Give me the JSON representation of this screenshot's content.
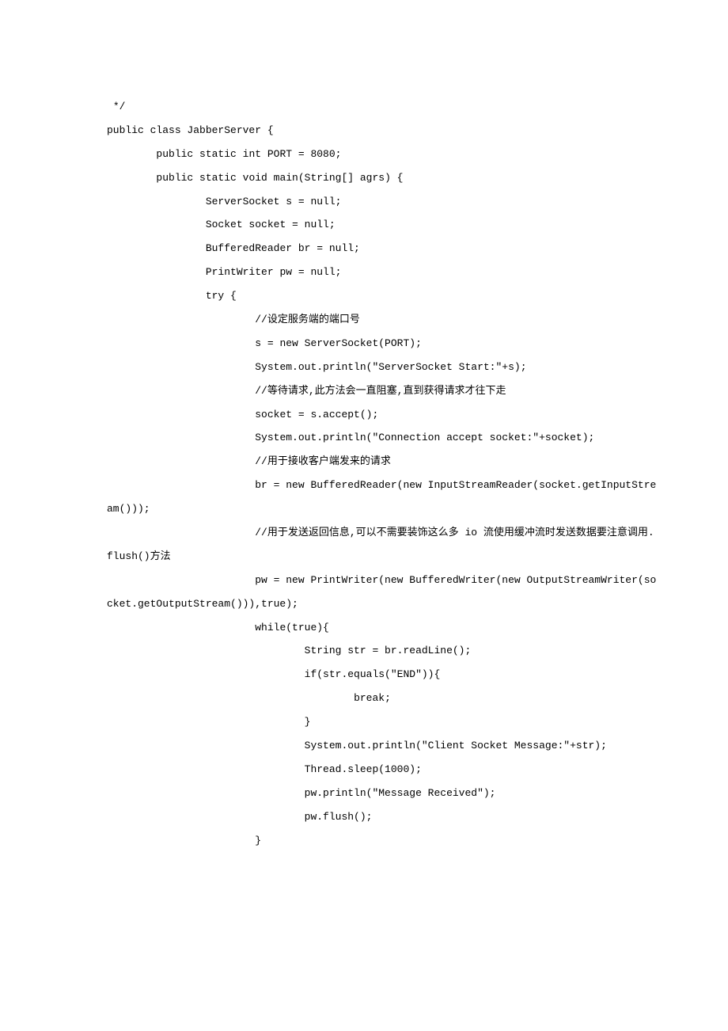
{
  "lines": [
    " */",
    "public class JabberServer {",
    "",
    "        public static int PORT = 8080;",
    "        public static void main(String[] agrs) {",
    "                ServerSocket s = null;",
    "                Socket socket = null;",
    "                BufferedReader br = null;",
    "                PrintWriter pw = null;",
    "                try {",
    "                        //设定服务端的端口号",
    "                        s = new ServerSocket(PORT);",
    "                        System.out.println(\"ServerSocket Start:\"+s);",
    "                        //等待请求,此方法会一直阻塞,直到获得请求才往下走",
    "                        socket = s.accept();",
    "                        System.out.println(\"Connection accept socket:\"+socket);",
    "                        //用于接收客户端发来的请求",
    "                        br = new BufferedReader(new InputStreamReader(socket.getInputStream()));",
    "                        //用于发送返回信息,可以不需要装饰这么多 io 流使用缓冲流时发送数据要注意调用.flush()方法",
    "                        pw = new PrintWriter(new BufferedWriter(new OutputStreamWriter(socket.getOutputStream())),true);",
    "                        while(true){",
    "                                String str = br.readLine();",
    "                                if(str.equals(\"END\")){",
    "                                        break;",
    "                                }",
    "                                System.out.println(\"Client Socket Message:\"+str);",
    "                                Thread.sleep(1000);",
    "                                pw.println(\"Message Received\");",
    "                                pw.flush();",
    "                        }"
  ]
}
